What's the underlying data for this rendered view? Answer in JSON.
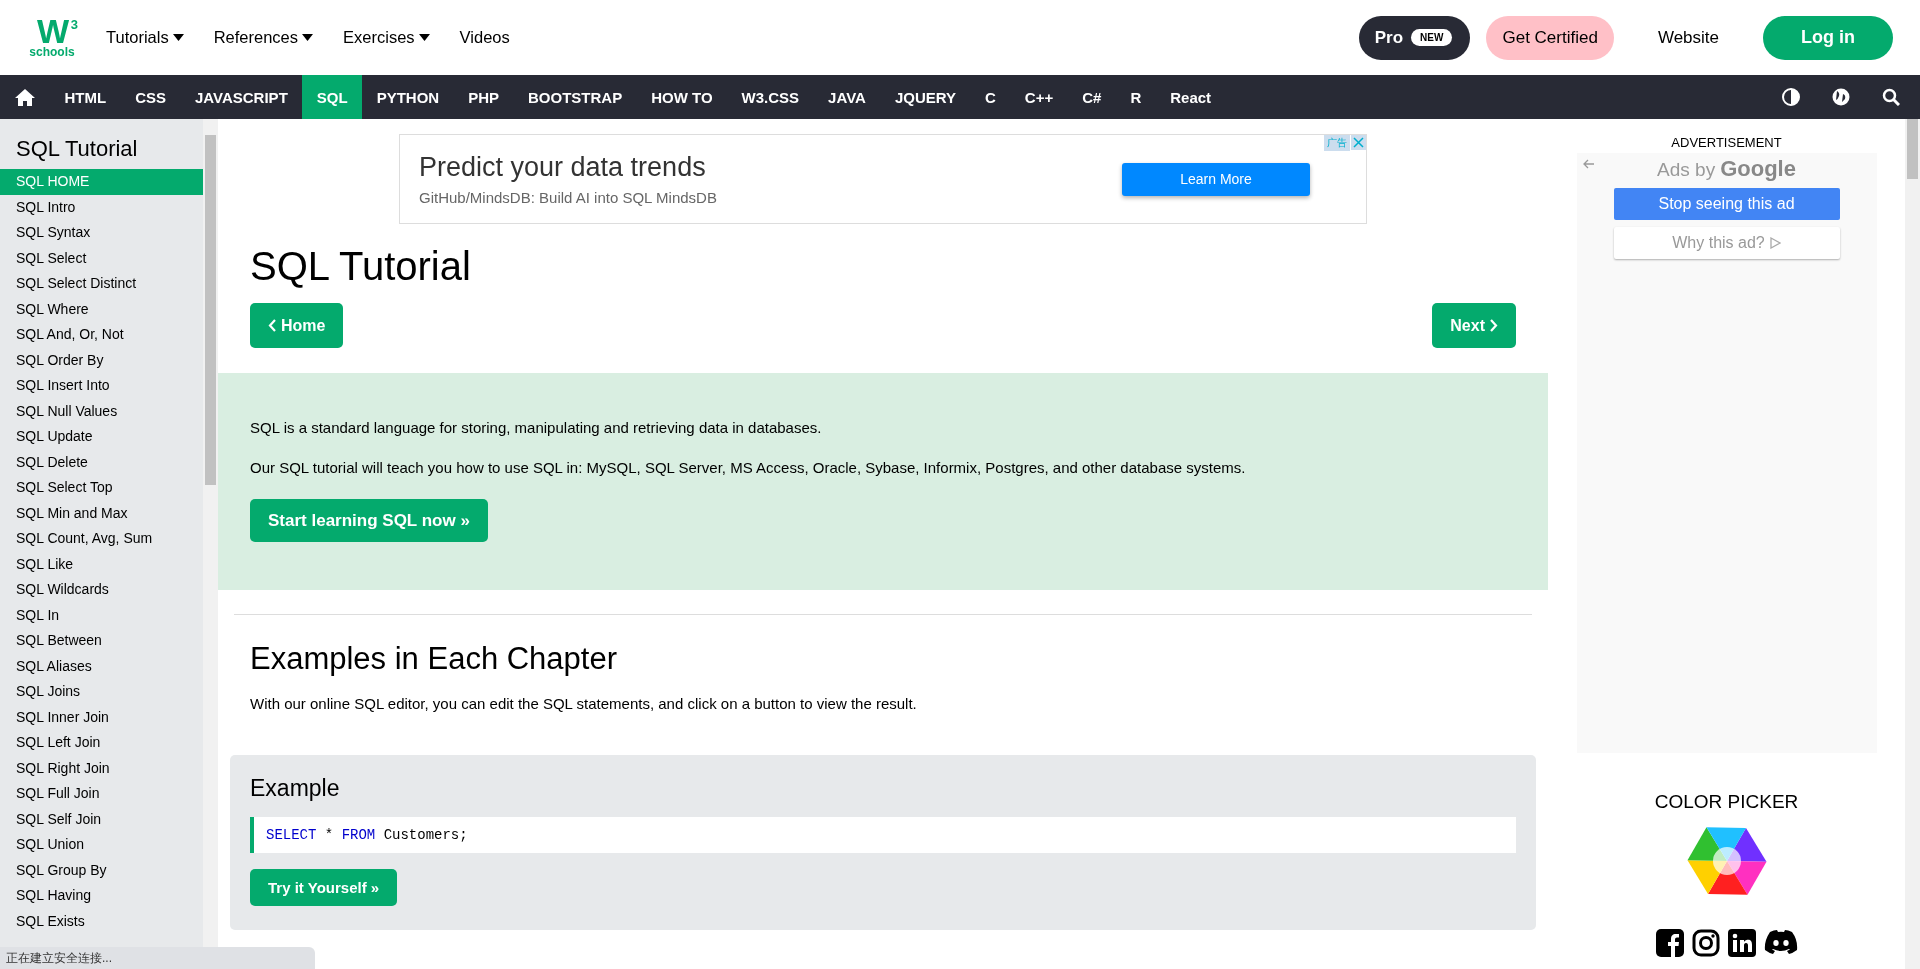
{
  "header": {
    "logo": {
      "mark": "W",
      "sup": "3",
      "word": "schools"
    },
    "menu": [
      {
        "label": "Tutorials",
        "dropdown": true
      },
      {
        "label": "References",
        "dropdown": true
      },
      {
        "label": "Exercises",
        "dropdown": true
      },
      {
        "label": "Videos",
        "dropdown": false
      }
    ],
    "pro": {
      "label": "Pro",
      "badge": "NEW"
    },
    "certified": "Get Certified",
    "website": "Website",
    "login": "Log in"
  },
  "topnav": {
    "items": [
      {
        "label": "HTML",
        "selected": false
      },
      {
        "label": "CSS",
        "selected": false
      },
      {
        "label": "JAVASCRIPT",
        "selected": false
      },
      {
        "label": "SQL",
        "selected": true
      },
      {
        "label": "PYTHON",
        "selected": false
      },
      {
        "label": "PHP",
        "selected": false
      },
      {
        "label": "BOOTSTRAP",
        "selected": false
      },
      {
        "label": "HOW TO",
        "selected": false
      },
      {
        "label": "W3.CSS",
        "selected": false
      },
      {
        "label": "JAVA",
        "selected": false
      },
      {
        "label": "JQUERY",
        "selected": false
      },
      {
        "label": "C",
        "selected": false
      },
      {
        "label": "C++",
        "selected": false
      },
      {
        "label": "C#",
        "selected": false
      },
      {
        "label": "R",
        "selected": false
      },
      {
        "label": "React",
        "selected": false
      }
    ]
  },
  "sidebar": {
    "title": "SQL Tutorial",
    "items": [
      {
        "label": "SQL HOME",
        "selected": true
      },
      {
        "label": "SQL Intro",
        "selected": false
      },
      {
        "label": "SQL Syntax",
        "selected": false
      },
      {
        "label": "SQL Select",
        "selected": false
      },
      {
        "label": "SQL Select Distinct",
        "selected": false
      },
      {
        "label": "SQL Where",
        "selected": false
      },
      {
        "label": "SQL And, Or, Not",
        "selected": false
      },
      {
        "label": "SQL Order By",
        "selected": false
      },
      {
        "label": "SQL Insert Into",
        "selected": false
      },
      {
        "label": "SQL Null Values",
        "selected": false
      },
      {
        "label": "SQL Update",
        "selected": false
      },
      {
        "label": "SQL Delete",
        "selected": false
      },
      {
        "label": "SQL Select Top",
        "selected": false
      },
      {
        "label": "SQL Min and Max",
        "selected": false
      },
      {
        "label": "SQL Count, Avg, Sum",
        "selected": false
      },
      {
        "label": "SQL Like",
        "selected": false
      },
      {
        "label": "SQL Wildcards",
        "selected": false
      },
      {
        "label": "SQL In",
        "selected": false
      },
      {
        "label": "SQL Between",
        "selected": false
      },
      {
        "label": "SQL Aliases",
        "selected": false
      },
      {
        "label": "SQL Joins",
        "selected": false
      },
      {
        "label": "SQL Inner Join",
        "selected": false
      },
      {
        "label": "SQL Left Join",
        "selected": false
      },
      {
        "label": "SQL Right Join",
        "selected": false
      },
      {
        "label": "SQL Full Join",
        "selected": false
      },
      {
        "label": "SQL Self Join",
        "selected": false
      },
      {
        "label": "SQL Union",
        "selected": false
      },
      {
        "label": "SQL Group By",
        "selected": false
      },
      {
        "label": "SQL Having",
        "selected": false
      },
      {
        "label": "SQL Exists",
        "selected": false
      }
    ]
  },
  "ad_banner": {
    "headline": "Predict your data trends",
    "subline": "GitHub/MindsDB: Build AI into SQL MindsDB",
    "button": "Learn More",
    "badge": "广告"
  },
  "main": {
    "title": "SQL Tutorial",
    "prev": "Home",
    "next": "Next",
    "intro": [
      "SQL is a standard language for storing, manipulating and retrieving data in databases.",
      "Our SQL tutorial will teach you how to use SQL in: MySQL, SQL Server, MS Access, Oracle, Sybase, Informix, Postgres, and other database systems."
    ],
    "cta": "Start learning SQL now »",
    "section_title": "Examples in Each Chapter",
    "section_text": "With our online SQL editor, you can edit the SQL statements, and click on a button to view the result.",
    "example": {
      "title": "Example",
      "code": [
        {
          "text": "SELECT",
          "kind": "keyword"
        },
        {
          "text": " * ",
          "kind": "plain"
        },
        {
          "text": "FROM",
          "kind": "keyword"
        },
        {
          "text": " Customers;",
          "kind": "plain"
        }
      ],
      "button": "Try it Yourself »"
    }
  },
  "right": {
    "ad_label": "ADVERTISEMENT",
    "ads_by": "Ads by",
    "google": "Google",
    "stop": "Stop seeing this ad",
    "why": "Why this ad?",
    "color_picker": "COLOR PICKER"
  },
  "status_bar": "正在建立安全连接..."
}
